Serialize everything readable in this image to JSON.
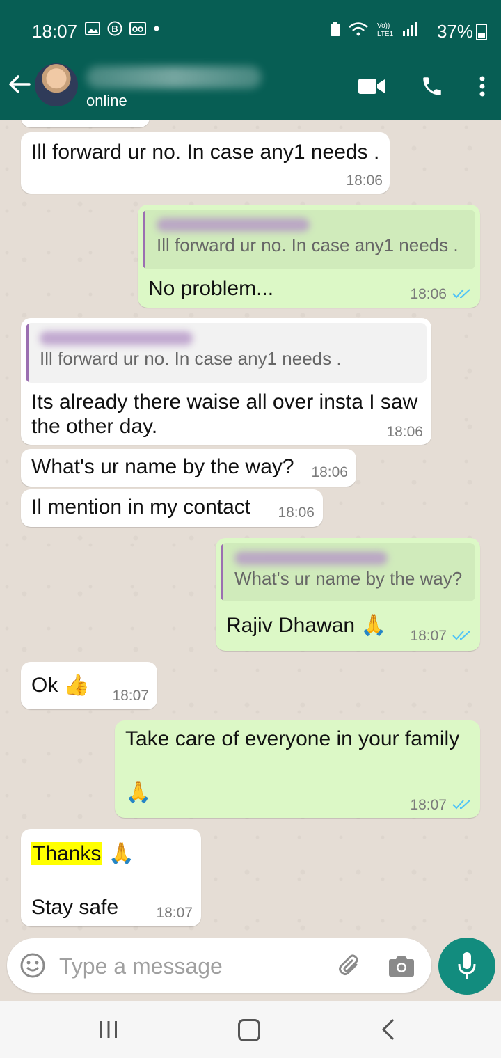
{
  "status": {
    "time": "18:07",
    "battery": "37%"
  },
  "header": {
    "status": "online"
  },
  "messages": [
    {
      "dir": "in",
      "text": "Ill forward ur no. In case any1 needs .",
      "time": "18:06"
    },
    {
      "dir": "out",
      "quote": "Ill forward ur no. In case any1 needs .",
      "text": "No problem...",
      "time": "18:06"
    },
    {
      "dir": "in",
      "quote": "Ill forward ur no. In case any1 needs .",
      "text_line1": "Its already there waise all over insta I saw",
      "text_line2": "the other day.",
      "time": "18:06"
    },
    {
      "dir": "in",
      "text": "What's ur name by the way?",
      "time": "18:06"
    },
    {
      "dir": "in",
      "text": "Il mention in my contact",
      "time": "18:06"
    },
    {
      "dir": "out",
      "quote": "What's ur name by the way?",
      "text": "Rajiv Dhawan 🙏",
      "time": "18:07"
    },
    {
      "dir": "in",
      "text": "Ok 👍",
      "time": "18:07"
    },
    {
      "dir": "out",
      "text": "Take care of everyone in your family",
      "text2": "🙏",
      "time": "18:07"
    },
    {
      "dir": "in",
      "highlight": "Thanks",
      "text": "🙏",
      "text2": "Stay safe",
      "time": "18:07"
    }
  ],
  "input": {
    "placeholder": "Type a message"
  },
  "icons": {
    "back": "back-arrow-icon",
    "video": "video-call-icon",
    "call": "voice-call-icon",
    "menu": "more-vertical-icon",
    "emoji": "emoji-icon",
    "attach": "paperclip-icon",
    "camera": "camera-icon",
    "mic": "microphone-icon"
  },
  "colors": {
    "header": "#075e54",
    "incoming": "#ffffff",
    "outgoing": "#dcf8c6",
    "read_ticks": "#4fc3f7",
    "mic_button": "#128c7e"
  }
}
